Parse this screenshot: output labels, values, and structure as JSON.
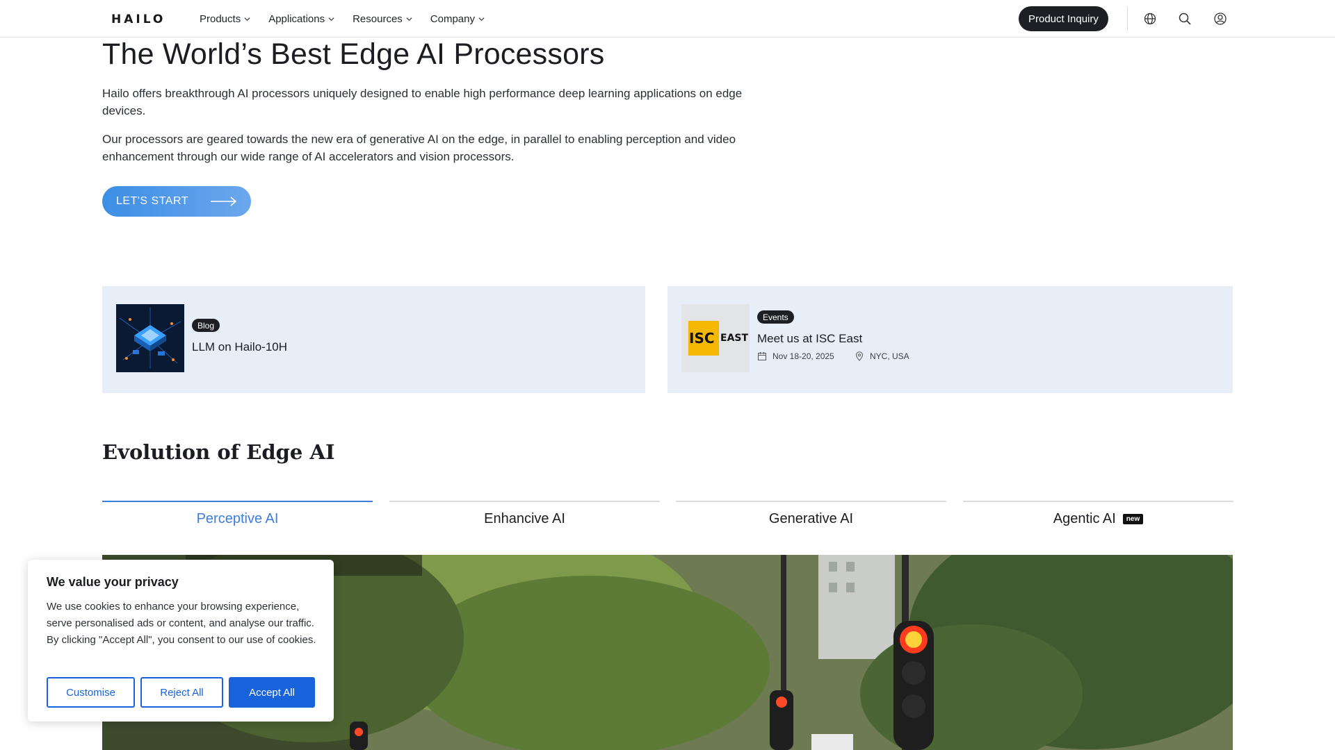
{
  "header": {
    "logo": "HAILO",
    "nav": [
      {
        "label": "Products"
      },
      {
        "label": "Applications"
      },
      {
        "label": "Resources"
      },
      {
        "label": "Company"
      }
    ],
    "inquiry_label": "Product Inquiry",
    "icons": [
      "globe-icon",
      "search-icon",
      "user-icon"
    ]
  },
  "hero": {
    "title": "The World’s Best Edge AI Processors",
    "paragraph1": "Hailo offers breakthrough AI processors uniquely designed to enable high performance deep learning applications on edge devices.",
    "paragraph2": "Our processors are geared towards the new era of generative AI on the edge, in parallel to enabling perception and video enhancement through our wide range of AI accelerators and vision processors.",
    "cta_label": "LET'S START"
  },
  "promos": {
    "blog": {
      "badge": "Blog",
      "title": "LLM on Hailo-10H"
    },
    "event": {
      "badge": "Events",
      "title": "Meet us at ISC East",
      "date": "Nov 18-20, 2025",
      "location": "NYC, USA",
      "logo_text": "ISC EAST"
    }
  },
  "evolution": {
    "title": "Evolution of Edge AI",
    "tabs": [
      {
        "label": "Perceptive AI",
        "active": true
      },
      {
        "label": "Enhancive AI",
        "active": false
      },
      {
        "label": "Generative AI",
        "active": false
      },
      {
        "label": "Agentic AI",
        "active": false,
        "badge": "new"
      }
    ]
  },
  "cookie": {
    "title": "We value your privacy",
    "text": "We use cookies to enhance your browsing experience, serve personalised ads or content, and analyse our traffic. By clicking \"Accept All\", you consent to our use of cookies.",
    "customise": "Customise",
    "reject": "Reject All",
    "accept": "Accept All"
  },
  "colors": {
    "accent": "#3b7de0",
    "dark": "#1d1f24",
    "card_bg": "#e7eef7",
    "cookie_blue": "#1863dc"
  }
}
